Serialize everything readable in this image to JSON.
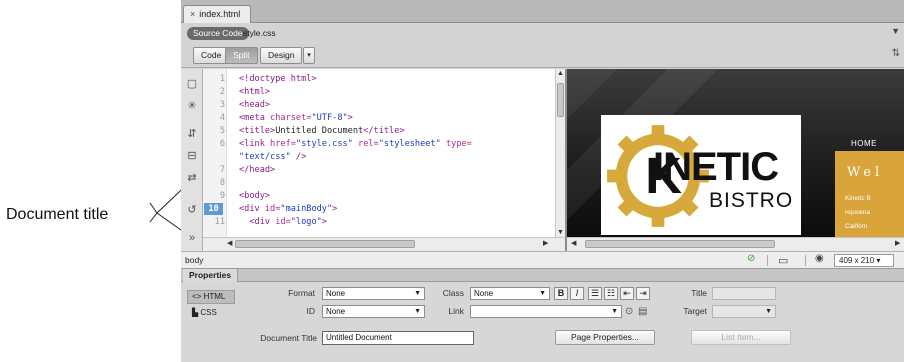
{
  "callout": {
    "label": "Document title"
  },
  "tabbar": {
    "close_glyph": "×",
    "doc_tab": "index.html"
  },
  "related_files": {
    "source_code": "Source Code",
    "style_file": "style.css",
    "filter_icon": "funnel-icon"
  },
  "view_bar": {
    "code": "Code",
    "split": "Split",
    "design": "Design",
    "dropdown_glyph": "▾",
    "right_icon": "upload-download-arrows-icon",
    "right_glyph": "⇅"
  },
  "toolstrip": {
    "icons": [
      "open-document-icon",
      "expand-collapse-icon",
      "collapse-tag-icon",
      "select-parent-icon",
      "balance-braces-icon",
      "wrap-tag-icon",
      "more-icon"
    ]
  },
  "code": {
    "lines": [
      {
        "n": "1",
        "parts": [
          {
            "c": "tg",
            "t": "<!doctype html>"
          }
        ]
      },
      {
        "n": "2",
        "parts": [
          {
            "c": "tg",
            "t": "<html>"
          }
        ]
      },
      {
        "n": "3",
        "parts": [
          {
            "c": "tg",
            "t": "<head>"
          }
        ]
      },
      {
        "n": "4",
        "parts": [
          {
            "c": "tg",
            "t": "<meta "
          },
          {
            "c": "at",
            "t": "charset="
          },
          {
            "c": "av",
            "t": "\"UTF-8\""
          },
          {
            "c": "tg",
            "t": ">"
          }
        ]
      },
      {
        "n": "5",
        "parts": [
          {
            "c": "tg",
            "t": "<title>"
          },
          {
            "c": "plain",
            "t": "Untitled Document"
          },
          {
            "c": "tg",
            "t": "</title>"
          }
        ]
      },
      {
        "n": "6",
        "parts": [
          {
            "c": "tg",
            "t": "<link "
          },
          {
            "c": "at",
            "t": "href="
          },
          {
            "c": "av",
            "t": "\"style.css\""
          },
          {
            "c": "at",
            "t": " rel="
          },
          {
            "c": "av",
            "t": "\"stylesheet\""
          },
          {
            "c": "at",
            "t": " type="
          }
        ]
      },
      {
        "n": "",
        "parts": [
          {
            "c": "av",
            "t": "\"text/css\""
          },
          {
            "c": "tg",
            "t": " />"
          }
        ]
      },
      {
        "n": "7",
        "parts": [
          {
            "c": "tg",
            "t": "</head>"
          }
        ]
      },
      {
        "n": "8",
        "parts": []
      },
      {
        "n": "9",
        "parts": [
          {
            "c": "tg",
            "t": "<body>"
          }
        ]
      },
      {
        "n": "10",
        "current": true,
        "parts": [
          {
            "c": "tg",
            "t": "<div "
          },
          {
            "c": "at",
            "t": "id="
          },
          {
            "c": "av",
            "t": "\"mainBody\""
          },
          {
            "c": "tg",
            "t": ">"
          }
        ]
      },
      {
        "n": "11",
        "parts": [
          {
            "c": "tg",
            "t": "  <div "
          },
          {
            "c": "at",
            "t": "id="
          },
          {
            "c": "av",
            "t": "\"logo\""
          },
          {
            "c": "tg",
            "t": ">"
          }
        ]
      }
    ]
  },
  "live": {
    "logo_main": "INETIC",
    "logo_initial": "K",
    "logo_sub": "BISTRO",
    "nav_home": "HOME",
    "welcome": "Wel",
    "panel_lines": [
      "Kinetic B",
      "rejuvena",
      "Californ"
    ]
  },
  "status": {
    "tag_selector": "body",
    "ok_glyph": "⊘",
    "window_size": "409 x 210 ▾",
    "accent_green": "#3a9b3a"
  },
  "properties": {
    "tab": "Properties",
    "html_mode": "<> HTML",
    "css_mode": "CSS",
    "format_label": "Format",
    "format_value": "None",
    "id_label": "ID",
    "id_value": "None",
    "class_label": "Class",
    "class_value": "None",
    "link_label": "Link",
    "link_value": "",
    "bold": "B",
    "italic": "I",
    "title_label": "Title",
    "target_label": "Target",
    "document_title_label": "Document Title",
    "document_title_value": "Untitled Document",
    "page_properties": "Page Properties...",
    "list_item": "List Item..."
  }
}
